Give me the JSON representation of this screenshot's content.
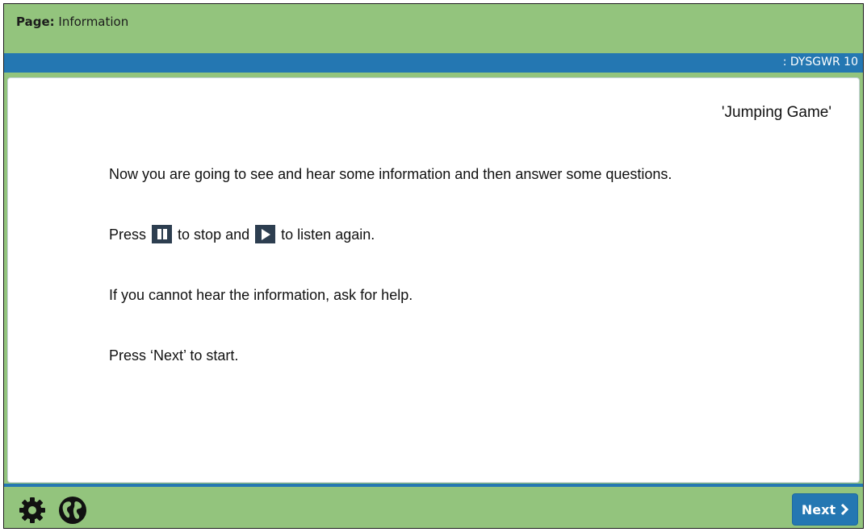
{
  "header": {
    "page_label": "Page:",
    "page_name": "Information",
    "code": ": DYSGWR 10"
  },
  "content": {
    "game_title": "'Jumping Game'",
    "line1": "Now you are going to see and hear some information and then answer some questions.",
    "line2_a": "Press",
    "line2_b": "to stop and",
    "line2_c": "to listen again.",
    "line3": "If you cannot hear the information, ask for help.",
    "line4": "Press ‘Next’ to start."
  },
  "footer": {
    "next_label": "Next",
    "icons": [
      "gear-icon",
      "globe-icon",
      "chevron-right-icon"
    ]
  },
  "colors": {
    "green": "#93c47d",
    "blue": "#2477b2",
    "control_dark": "#2d3e50"
  }
}
